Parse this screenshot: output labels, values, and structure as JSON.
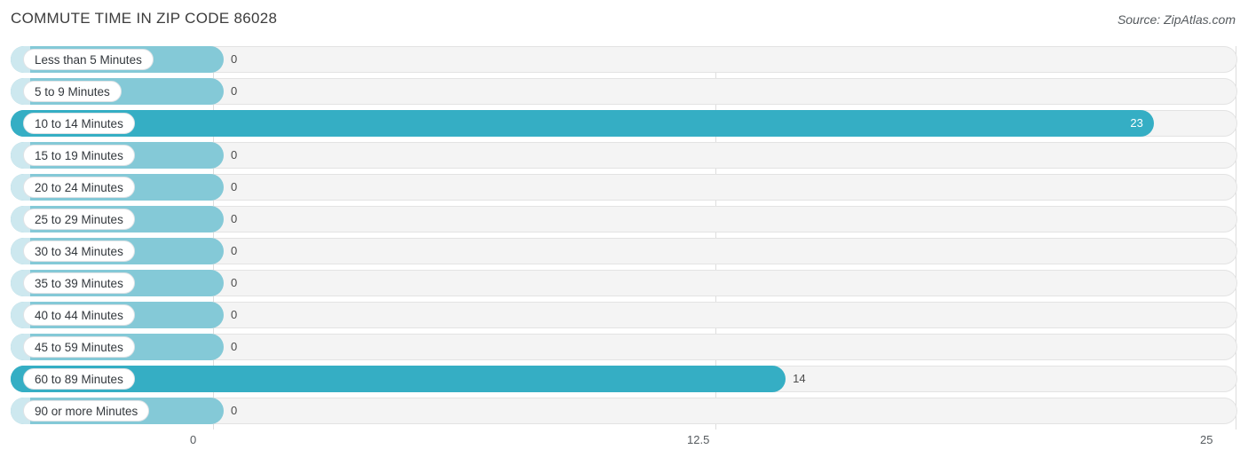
{
  "header": {
    "title": "COMMUTE TIME IN ZIP CODE 86028",
    "source": "Source: ZipAtlas.com"
  },
  "axis": {
    "ticks": [
      "0",
      "12.5",
      "25"
    ]
  },
  "colors": {
    "bar_value": "#35aec4",
    "bar_zero": "#84c9d7",
    "cap_zero": "#cde8ef",
    "track": "#f4f4f4",
    "grid": "#dddddd",
    "title_text": "#3c3c3c"
  },
  "chart_data": {
    "type": "bar",
    "orientation": "horizontal",
    "title": "COMMUTE TIME IN ZIP CODE 86028",
    "subtitle": "Source: ZipAtlas.com",
    "xlabel": "",
    "ylabel": "",
    "xlim": [
      0,
      25
    ],
    "xticks": [
      0,
      12.5,
      25
    ],
    "grid": true,
    "legend": false,
    "categories": [
      "Less than 5 Minutes",
      "5 to 9 Minutes",
      "10 to 14 Minutes",
      "15 to 19 Minutes",
      "20 to 24 Minutes",
      "25 to 29 Minutes",
      "30 to 34 Minutes",
      "35 to 39 Minutes",
      "40 to 44 Minutes",
      "45 to 59 Minutes",
      "60 to 89 Minutes",
      "90 or more Minutes"
    ],
    "values": [
      0,
      0,
      23,
      0,
      0,
      0,
      0,
      0,
      0,
      0,
      14,
      0
    ],
    "value_labels": [
      "0",
      "0",
      "23",
      "0",
      "0",
      "0",
      "0",
      "0",
      "0",
      "0",
      "14",
      "0"
    ]
  }
}
